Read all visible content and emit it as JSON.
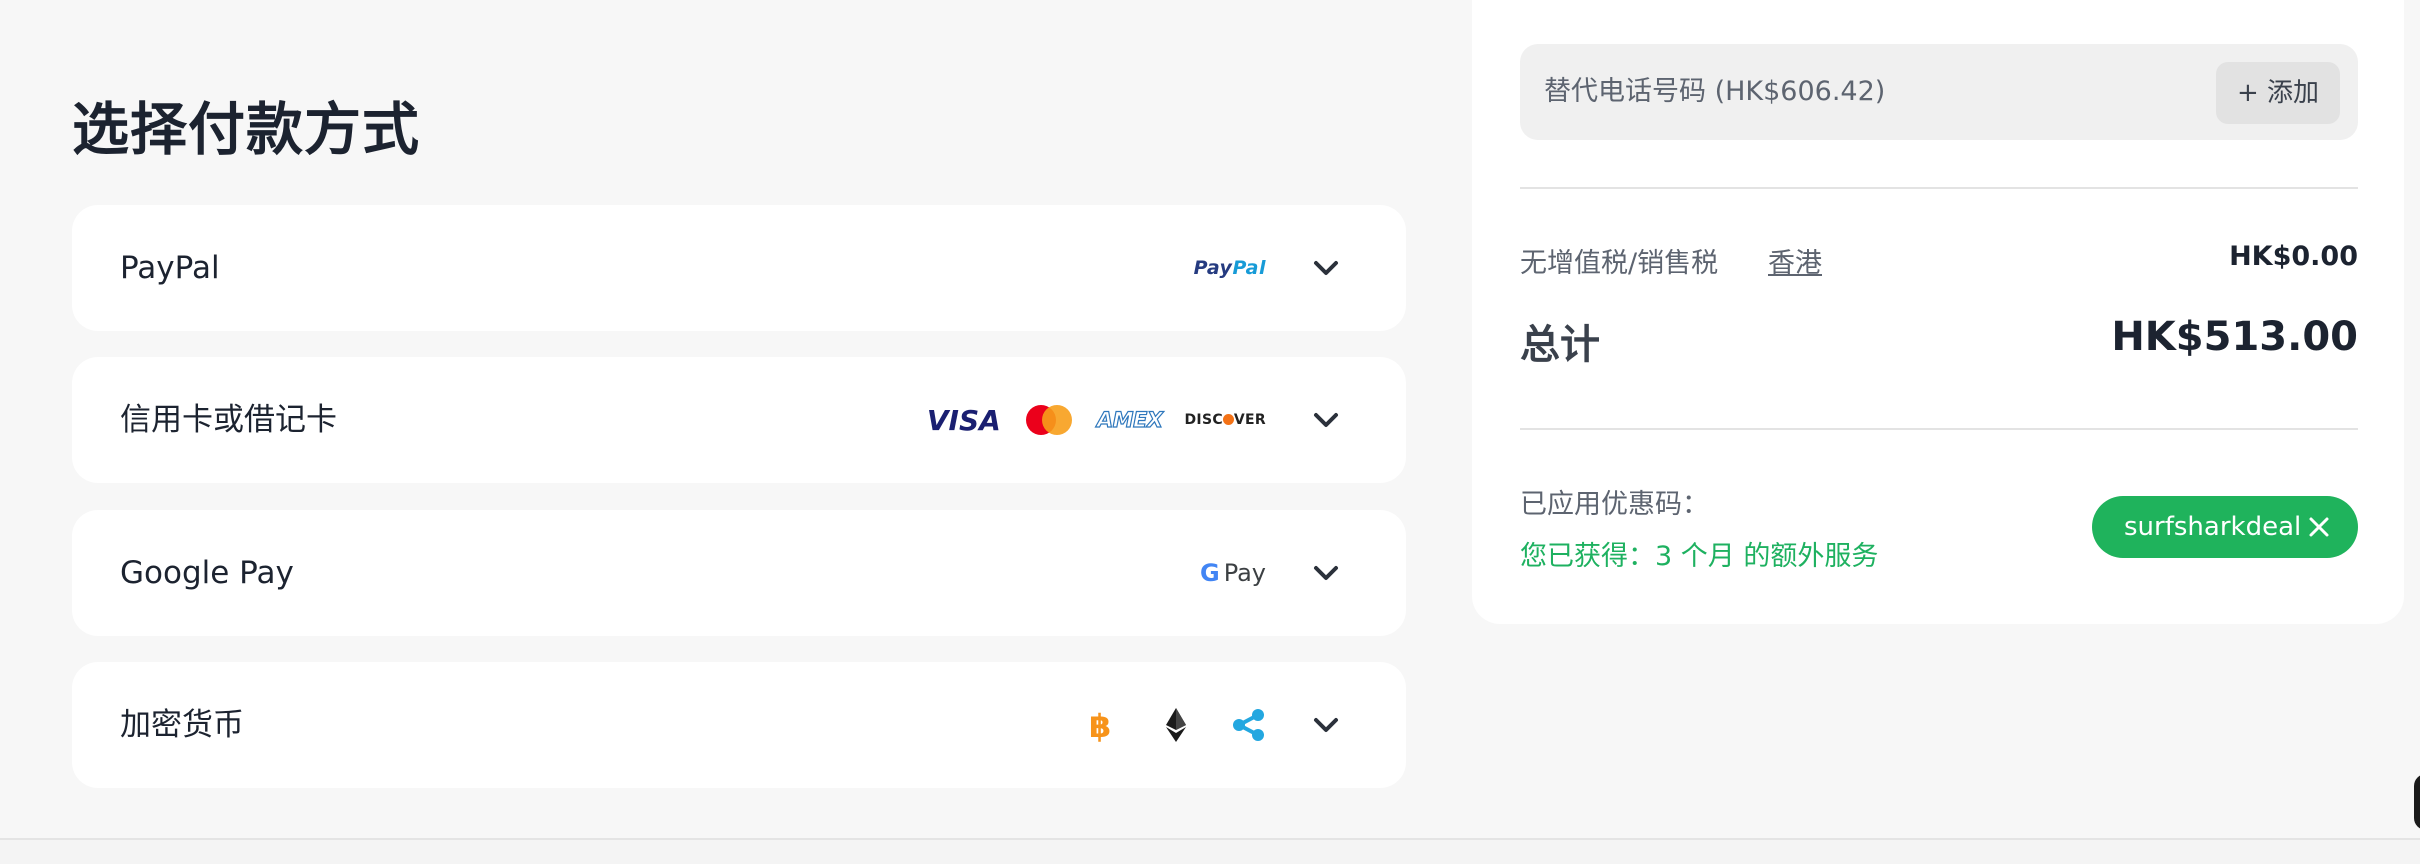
{
  "page": {
    "title": "选择付款方式"
  },
  "payment_methods": [
    {
      "label": "PayPal",
      "logos": [
        "paypal-logo"
      ],
      "logo_text": "PayPal"
    },
    {
      "label": "信用卡或借记卡",
      "logos": [
        "visa-logo",
        "mastercard-logo",
        "amex-logo",
        "discover-logo"
      ],
      "logo_texts": [
        "VISA",
        "AMEX",
        "DISCOVER"
      ]
    },
    {
      "label": "Google Pay",
      "logos": [
        "google-pay-logo"
      ],
      "logo_text": "Pay"
    },
    {
      "label": "加密货币",
      "logos": [
        "bitcoin-icon",
        "ethereum-icon",
        "ripple-icon"
      ]
    }
  ],
  "summary": {
    "phone": {
      "label": "替代电话号码 (HK$606.42)",
      "add_label": "+ 添加"
    },
    "tax": {
      "label": "无增值税/销售税",
      "region": "香港",
      "value": "HK$0.00"
    },
    "total": {
      "label": "总计",
      "value": "HK$513.00"
    },
    "promo": {
      "label": "已应用优惠码：",
      "gain": "您已获得：3 个月 的额外服务",
      "code": "surfsharkdeal"
    }
  },
  "colors": {
    "accent_green": "#1fb35c",
    "bitcoin_orange": "#f7931a",
    "ripple_blue": "#23a7e0",
    "mastercard_red": "#eb001b",
    "mastercard_yellow": "#f79e1b",
    "visa_blue": "#1a1f71",
    "amex_blue": "#2e77bc",
    "paypal_dark": "#253b80",
    "paypal_light": "#179bd7"
  }
}
